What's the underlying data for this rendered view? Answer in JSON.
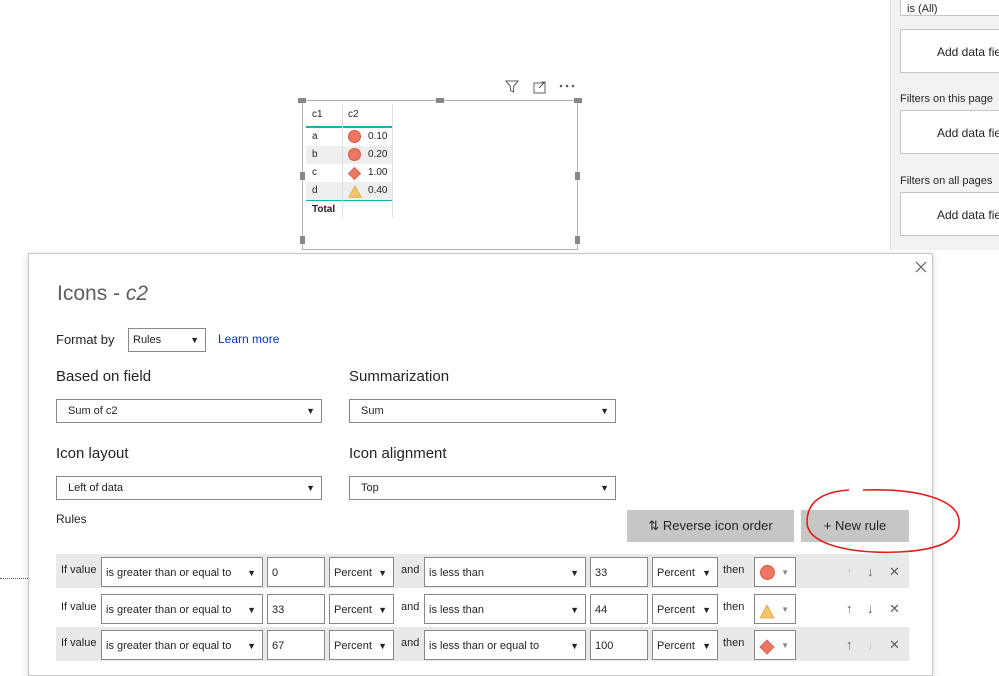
{
  "filter_pane": {
    "top_filter_value": "is (All)",
    "add_data_fields_label": "Add data fields",
    "sections": [
      {
        "label": ""
      },
      {
        "label": "Filters on this page"
      },
      {
        "label": "Filters on all pages"
      }
    ]
  },
  "visual_table": {
    "headers": [
      "c1",
      "c2"
    ],
    "rows": [
      {
        "c1": "a",
        "c2": "0.10",
        "icon": "circle-icon"
      },
      {
        "c1": "b",
        "c2": "0.20",
        "icon": "circle-icon"
      },
      {
        "c1": "c",
        "c2": "1.00",
        "icon": "diamond-icon"
      },
      {
        "c1": "d",
        "c2": "0.40",
        "icon": "triangle-icon"
      }
    ],
    "total_label": "Total"
  },
  "visual_header_icons": [
    "filter-icon",
    "focus-mode-icon",
    "more-options-icon"
  ],
  "dialog": {
    "title_prefix": "Icons - ",
    "title_field": "c2",
    "format_by_label": "Format by",
    "format_by_value": "Rules",
    "learn_more": "Learn more",
    "based_on_field_label": "Based on field",
    "based_on_field_value": "Sum of c2",
    "summarization_label": "Summarization",
    "summarization_value": "Sum",
    "icon_layout_label": "Icon layout",
    "icon_layout_value": "Left of data",
    "icon_alignment_label": "Icon alignment",
    "icon_alignment_value": "Top",
    "rules_label": "Rules",
    "reverse_icon_order": "Reverse icon order",
    "new_rule": "New rule",
    "rules": [
      {
        "if_value": "If value",
        "op1": "is greater than or equal to",
        "val1": "0",
        "unit1": "Percent",
        "and": "and",
        "op2": "is less than",
        "val2": "33",
        "unit2": "Percent",
        "then": "then",
        "icon": "circle-icon"
      },
      {
        "if_value": "If value",
        "op1": "is greater than or equal to",
        "val1": "33",
        "unit1": "Percent",
        "and": "and",
        "op2": "is less than",
        "val2": "44",
        "unit2": "Percent",
        "then": "then",
        "icon": "triangle-icon"
      },
      {
        "if_value": "If value",
        "op1": "is greater than or equal to",
        "val1": "67",
        "unit1": "Percent",
        "and": "and",
        "op2": "is less than or equal to",
        "val2": "100",
        "unit2": "Percent",
        "then": "then",
        "icon": "diamond-icon"
      }
    ]
  },
  "colors": {
    "icon_red": "#ed7662",
    "icon_yellow": "#f5c36b",
    "link_blue": "#0033cc",
    "annotation_red": "#e02020",
    "accent_teal": "#01b8aa"
  }
}
